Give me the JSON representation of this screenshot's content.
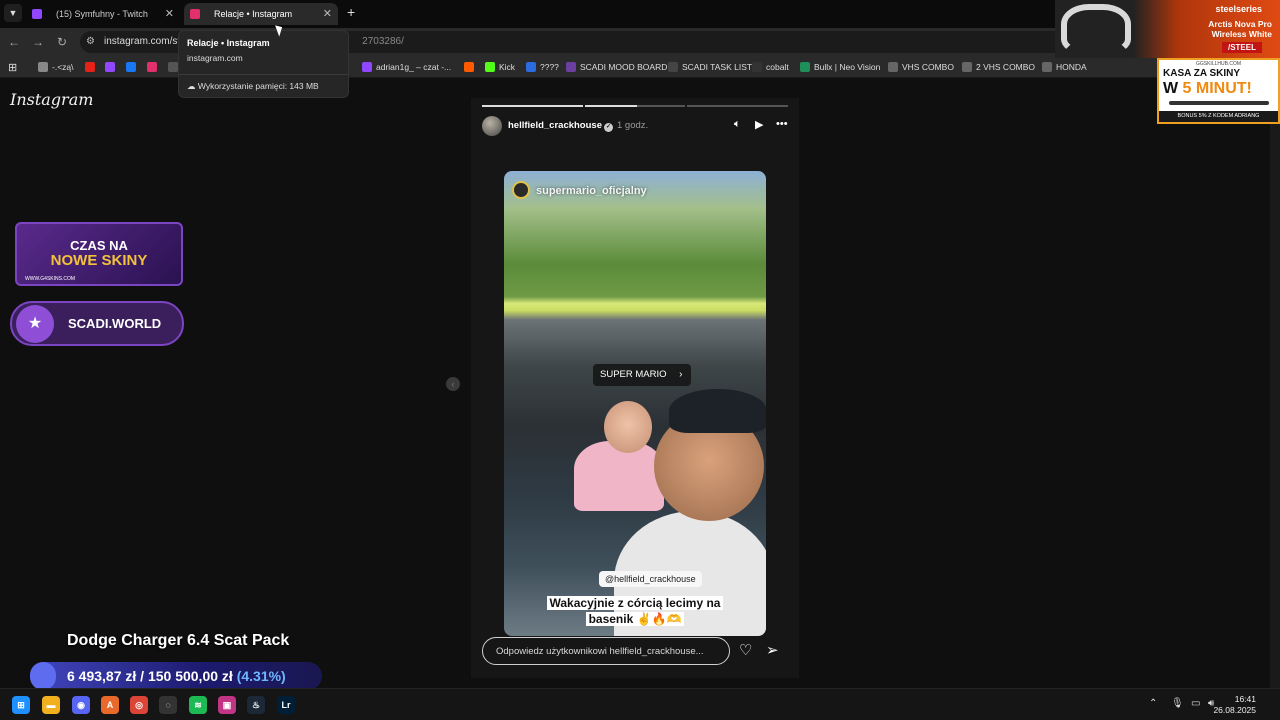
{
  "browser": {
    "tabs": [
      {
        "label": "(15) Symfuhny - Twitch",
        "favicon_color": "#9146ff",
        "active": false
      },
      {
        "label": "Relacje • Instagram",
        "favicon_color": "#e1306c",
        "active": true
      }
    ],
    "new_tab": "+",
    "url_domain": "instagram.com/st",
    "url_path": "2703286/",
    "tooltip": {
      "title": "Relacje • Instagram",
      "domain": "instagram.com",
      "memory": "Wykorzystanie pamięci: 143 MB"
    },
    "bookmarks": [
      {
        "label": "-.<zą\\",
        "color": "#888"
      },
      {
        "label": "",
        "color": "#e62117"
      },
      {
        "label": "",
        "color": "#9146ff"
      },
      {
        "label": "",
        "color": "#1877f2"
      },
      {
        "label": "",
        "color": "#e1306c"
      },
      {
        "label": "",
        "color": "#555"
      },
      {
        "label": "adrian1g_ – czat -...",
        "color": "#9146ff"
      },
      {
        "label": "",
        "color": "#ff5a00"
      },
      {
        "label": "Kick",
        "color": "#53fc18"
      },
      {
        "label": "????",
        "color": "#2d6cdf"
      },
      {
        "label": "SCADI MOOD BOARD",
        "color": "#6b3fa0"
      },
      {
        "label": "SCADI TASK LIST",
        "color": "#444"
      },
      {
        "label": "cobalt",
        "color": "#333"
      },
      {
        "label": "Bullx | Neo Vision",
        "color": "#1f8f5a"
      },
      {
        "label": "VHS COMBO",
        "color": "#666"
      },
      {
        "label": "2 VHS COMBO",
        "color": "#666"
      },
      {
        "label": "HONDA",
        "color": "#666"
      }
    ]
  },
  "instagram": {
    "logo": "Instagram",
    "story": {
      "username": "hellfield_crackhouse",
      "time": "1 godz.",
      "progress": [
        1,
        0.52,
        0
      ],
      "inner_username": "supermario_oficjalny",
      "music": "SUPER MARIO",
      "mention": "@hellfield_crackhouse",
      "caption_line1": "Wakacyjnie z córcią lecimy na",
      "caption_line2": "basenik ✌️🔥🫶",
      "reply_placeholder": "Odpowiedz użytkownikowi hellfield_crackhouse..."
    }
  },
  "overlays": {
    "steelseries": {
      "brand": "steelseries",
      "product": "Arctis Nova Pro Wireless White",
      "code": "/STEEL"
    },
    "kasa": {
      "top": "GGSKILLHUB.COM",
      "line1": "KASA ZA SKINY",
      "line2_prefix": "W ",
      "line2_highlight": "5 MINUT!",
      "bottom": "BONUS 5% Z KODEM ADRIANG"
    },
    "skins": {
      "line1": "CZAS NA",
      "line2": "NOWE SKINY",
      "url": "WWW.G4SKINS.COM"
    },
    "scadi": {
      "text": "SCADI.WORLD"
    },
    "goal": {
      "title": "Dodge Charger 6.4 Scat Pack",
      "current": "6 493,87 zł",
      "separator": "/",
      "target": "150 500,00 zł",
      "percent_label": "(4.31%)",
      "fraction": 0.0431
    }
  },
  "taskbar": {
    "apps": [
      {
        "name": "windows",
        "color": "#1e90ff",
        "glyph": "⊞"
      },
      {
        "name": "explorer",
        "color": "#f2b01e",
        "glyph": "▬"
      },
      {
        "name": "discord",
        "color": "#5865f2",
        "glyph": "◉"
      },
      {
        "name": "app-a",
        "color": "#e8692a",
        "glyph": "A"
      },
      {
        "name": "chrome",
        "color": "#db4437",
        "glyph": "◎"
      },
      {
        "name": "obs",
        "color": "#333",
        "glyph": "◌"
      },
      {
        "name": "spotify",
        "color": "#1db954",
        "glyph": "≋"
      },
      {
        "name": "app-pink",
        "color": "#c13584",
        "glyph": "▣"
      },
      {
        "name": "steam",
        "color": "#1b2838",
        "glyph": "♨"
      },
      {
        "name": "lightroom",
        "color": "#001e36",
        "glyph": "Lr"
      }
    ],
    "time": "16:41",
    "date": "26.08.2025"
  }
}
